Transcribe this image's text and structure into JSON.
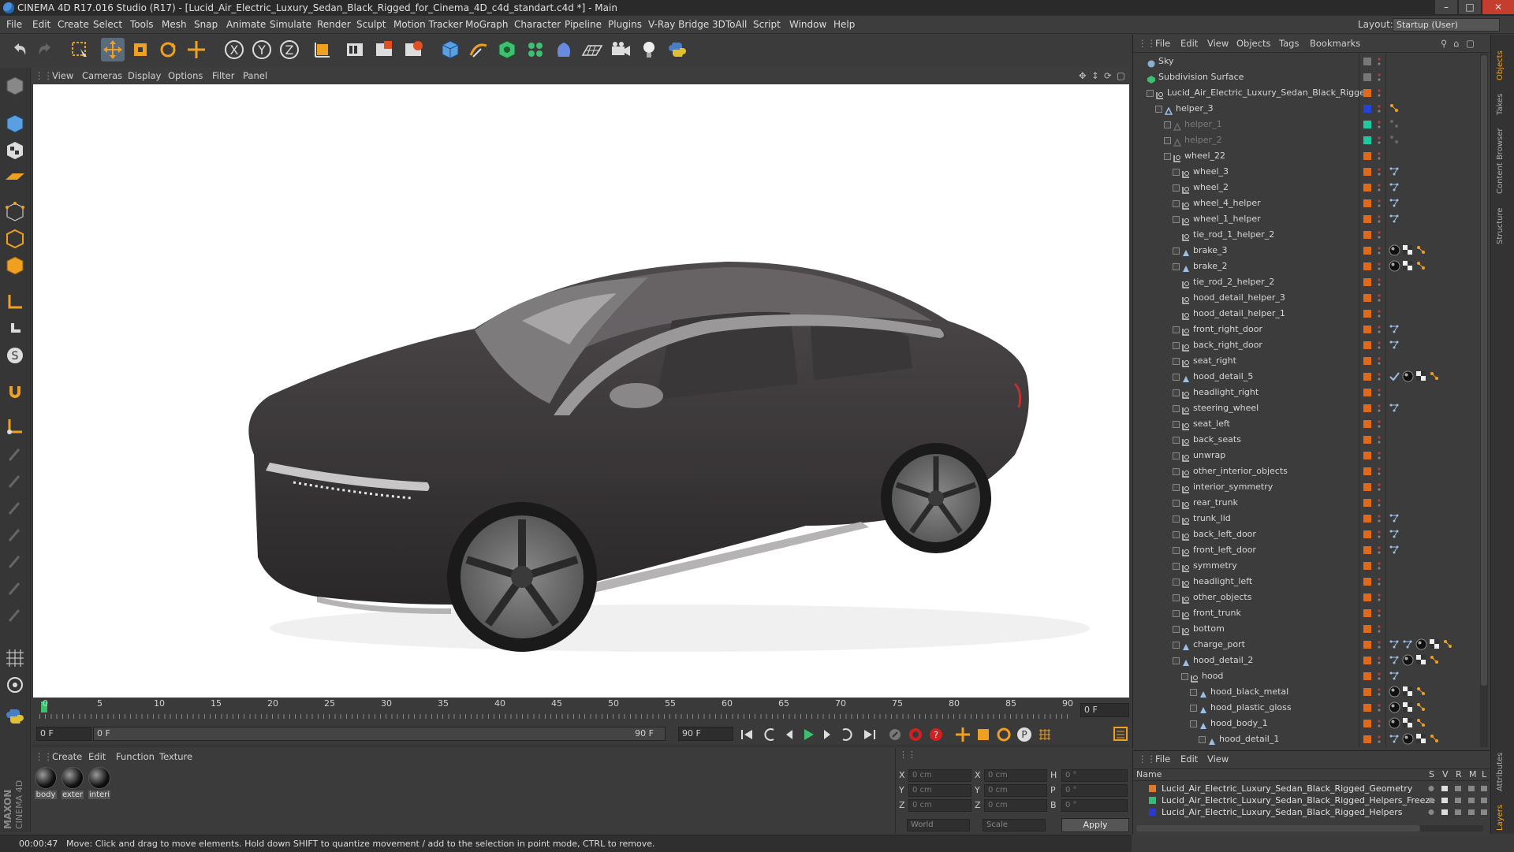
{
  "window": {
    "title": "CINEMA 4D R17.016 Studio (R17) - [Lucid_Air_Electric_Luxury_Sedan_Black_Rigged_for_Cinema_4D_c4d_standart.c4d *] - Main"
  },
  "menubar": {
    "items": [
      "File",
      "Edit",
      "Create",
      "Select",
      "Tools",
      "Mesh",
      "Snap",
      "Animate",
      "Simulate",
      "Render",
      "Sculpt",
      "Motion Tracker",
      "MoGraph",
      "Character",
      "Pipeline",
      "Plugins",
      "V-Ray Bridge",
      "3DToAll",
      "Script",
      "Window",
      "Help"
    ],
    "layout_label": "Layout:",
    "layout_value": "Startup (User)"
  },
  "viewport_menu": [
    "View",
    "Cameras",
    "Display",
    "Options",
    "Filter",
    "Panel"
  ],
  "timeline": {
    "ticks": [
      "0",
      "5",
      "10",
      "15",
      "20",
      "25",
      "30",
      "35",
      "40",
      "45",
      "50",
      "55",
      "60",
      "65",
      "70",
      "75",
      "80",
      "85",
      "90"
    ],
    "end_field": "0 F"
  },
  "playbar": {
    "current_frame": "0 F",
    "range_start": "0 F",
    "range_end": "90 F",
    "max_frame": "90 F"
  },
  "material_manager": {
    "menu": [
      "Create",
      "Edit",
      "Function",
      "Texture"
    ],
    "materials": [
      "body",
      "exter",
      "interi"
    ]
  },
  "coordinates": {
    "pos_labels": [
      "X",
      "Y",
      "Z"
    ],
    "size_labels": [
      "X",
      "Y",
      "Z"
    ],
    "rot_labels": [
      "H",
      "P",
      "B"
    ],
    "pos_values": [
      "0 cm",
      "0 cm",
      "0 cm"
    ],
    "size_values": [
      "0 cm",
      "0 cm",
      "0 cm"
    ],
    "rot_values": [
      "0 °",
      "0 °",
      "0 °"
    ],
    "mode1": "World",
    "mode2": "Scale",
    "apply_label": "Apply"
  },
  "status": {
    "time": "00:00:47",
    "message": "Move: Click and drag to move elements. Hold down SHIFT to quantize movement / add to the selection in point mode, CTRL to remove."
  },
  "object_manager": {
    "menu": [
      "File",
      "Edit",
      "View",
      "Objects",
      "Tags",
      "Bookmarks"
    ],
    "rows": [
      {
        "name": "Sky",
        "indent": 0,
        "icon": "sky",
        "vis": "grey",
        "dim": false,
        "tags": []
      },
      {
        "name": "Subdivision Surface",
        "indent": 0,
        "icon": "subdiv",
        "vis": "grey",
        "dim": false,
        "tags": []
      },
      {
        "name": "Lucid_Air_Electric_Luxury_Sedan_Black_Rigged",
        "indent": 1,
        "icon": "null",
        "vis": "orange",
        "dim": false,
        "tags": []
      },
      {
        "name": "helper_3",
        "indent": 2,
        "icon": "joint",
        "vis": "blue",
        "dim": false,
        "tags": [
          "ik"
        ]
      },
      {
        "name": "helper_1",
        "indent": 3,
        "icon": "joint",
        "vis": "teal",
        "dim": true,
        "tags": [
          "ik-dim"
        ]
      },
      {
        "name": "helper_2",
        "indent": 3,
        "icon": "joint",
        "vis": "teal",
        "dim": true,
        "tags": [
          "ik-dim"
        ]
      },
      {
        "name": "wheel_22",
        "indent": 3,
        "icon": "null",
        "vis": "orange",
        "dim": false,
        "tags": []
      },
      {
        "name": "wheel_3",
        "indent": 4,
        "icon": "null",
        "vis": "orange",
        "dim": false,
        "tags": [
          "xpresso"
        ]
      },
      {
        "name": "wheel_2",
        "indent": 4,
        "icon": "null",
        "vis": "orange",
        "dim": false,
        "tags": [
          "xpresso"
        ]
      },
      {
        "name": "wheel_4_helper",
        "indent": 4,
        "icon": "null",
        "vis": "orange",
        "dim": false,
        "tags": [
          "xpresso"
        ]
      },
      {
        "name": "wheel_1_helper",
        "indent": 4,
        "icon": "null",
        "vis": "orange",
        "dim": false,
        "tags": [
          "xpresso"
        ]
      },
      {
        "name": "tie_rod_1_helper_2",
        "indent": 4,
        "icon": "null",
        "vis": "orange",
        "dim": false,
        "tags": []
      },
      {
        "name": "brake_3",
        "indent": 4,
        "icon": "poly",
        "vis": "orange",
        "dim": false,
        "tags": [
          "mat",
          "check",
          "ik"
        ]
      },
      {
        "name": "brake_2",
        "indent": 4,
        "icon": "poly",
        "vis": "orange",
        "dim": false,
        "tags": [
          "mat",
          "check",
          "ik"
        ]
      },
      {
        "name": "tie_rod_2_helper_2",
        "indent": 4,
        "icon": "null",
        "vis": "orange",
        "dim": false,
        "tags": []
      },
      {
        "name": "hood_detail_helper_3",
        "indent": 4,
        "icon": "null",
        "vis": "orange",
        "dim": false,
        "tags": []
      },
      {
        "name": "hood_detail_helper_1",
        "indent": 4,
        "icon": "null",
        "vis": "orange",
        "dim": false,
        "tags": []
      },
      {
        "name": "front_right_door",
        "indent": 4,
        "icon": "null",
        "vis": "orange",
        "dim": false,
        "tags": [
          "xpresso"
        ]
      },
      {
        "name": "back_right_door",
        "indent": 4,
        "icon": "null",
        "vis": "orange",
        "dim": false,
        "tags": [
          "xpresso"
        ]
      },
      {
        "name": "seat_right",
        "indent": 4,
        "icon": "null",
        "vis": "orange",
        "dim": false,
        "tags": []
      },
      {
        "name": "hood_detail_5",
        "indent": 4,
        "icon": "poly",
        "vis": "orange",
        "dim": false,
        "tags": [
          "check2",
          "mat",
          "check",
          "ik"
        ]
      },
      {
        "name": "headlight_right",
        "indent": 4,
        "icon": "null",
        "vis": "orange",
        "dim": false,
        "tags": []
      },
      {
        "name": "steering_wheel",
        "indent": 4,
        "icon": "null",
        "vis": "orange",
        "dim": false,
        "tags": [
          "xpresso"
        ]
      },
      {
        "name": "seat_left",
        "indent": 4,
        "icon": "null",
        "vis": "orange",
        "dim": false,
        "tags": []
      },
      {
        "name": "back_seats",
        "indent": 4,
        "icon": "null",
        "vis": "orange",
        "dim": false,
        "tags": []
      },
      {
        "name": "unwrap",
        "indent": 4,
        "icon": "null",
        "vis": "orange",
        "dim": false,
        "tags": []
      },
      {
        "name": "other_interior_objects",
        "indent": 4,
        "icon": "null",
        "vis": "orange",
        "dim": false,
        "tags": []
      },
      {
        "name": "interior_symmetry",
        "indent": 4,
        "icon": "null",
        "vis": "orange",
        "dim": false,
        "tags": []
      },
      {
        "name": "rear_trunk",
        "indent": 4,
        "icon": "null",
        "vis": "orange",
        "dim": false,
        "tags": []
      },
      {
        "name": "trunk_lid",
        "indent": 4,
        "icon": "null",
        "vis": "orange",
        "dim": false,
        "tags": [
          "xpresso"
        ]
      },
      {
        "name": "back_left_door",
        "indent": 4,
        "icon": "null",
        "vis": "orange",
        "dim": false,
        "tags": [
          "xpresso"
        ]
      },
      {
        "name": "front_left_door",
        "indent": 4,
        "icon": "null",
        "vis": "orange",
        "dim": false,
        "tags": [
          "xpresso"
        ]
      },
      {
        "name": "symmetry",
        "indent": 4,
        "icon": "null",
        "vis": "orange",
        "dim": false,
        "tags": []
      },
      {
        "name": "headlight_left",
        "indent": 4,
        "icon": "null",
        "vis": "orange",
        "dim": false,
        "tags": []
      },
      {
        "name": "other_objects",
        "indent": 4,
        "icon": "null",
        "vis": "orange",
        "dim": false,
        "tags": []
      },
      {
        "name": "front_trunk",
        "indent": 4,
        "icon": "null",
        "vis": "orange",
        "dim": false,
        "tags": []
      },
      {
        "name": "bottom",
        "indent": 4,
        "icon": "null",
        "vis": "orange",
        "dim": false,
        "tags": []
      },
      {
        "name": "charge_port",
        "indent": 4,
        "icon": "poly",
        "vis": "orange",
        "dim": false,
        "tags": [
          "xpresso",
          "xpresso",
          "mat",
          "check",
          "ik"
        ]
      },
      {
        "name": "hood_detail_2",
        "indent": 4,
        "icon": "poly",
        "vis": "orange",
        "dim": false,
        "tags": [
          "xpresso",
          "mat",
          "check",
          "ik"
        ]
      },
      {
        "name": "hood",
        "indent": 5,
        "icon": "null",
        "vis": "orange",
        "dim": false,
        "tags": [
          "xpresso"
        ]
      },
      {
        "name": "hood_black_metal",
        "indent": 6,
        "icon": "poly",
        "vis": "orange",
        "dim": false,
        "tags": [
          "mat",
          "check",
          "ik"
        ]
      },
      {
        "name": "hood_plastic_gloss",
        "indent": 6,
        "icon": "poly",
        "vis": "orange",
        "dim": false,
        "tags": [
          "mat",
          "check",
          "ik"
        ]
      },
      {
        "name": "hood_body_1",
        "indent": 6,
        "icon": "poly",
        "vis": "orange",
        "dim": false,
        "tags": [
          "mat",
          "check",
          "ik"
        ]
      },
      {
        "name": "hood_detail_1",
        "indent": 7,
        "icon": "poly",
        "vis": "orange",
        "dim": false,
        "tags": [
          "xpresso",
          "mat",
          "check",
          "ik"
        ]
      }
    ]
  },
  "layer_manager": {
    "menu": [
      "File",
      "Edit",
      "View"
    ],
    "name_header": "Name",
    "col_headers": [
      "S",
      "V",
      "R",
      "M",
      "L"
    ],
    "layers": [
      {
        "name": "Lucid_Air_Electric_Luxury_Sedan_Black_Rigged_Geometry",
        "color": "#e07a2a"
      },
      {
        "name": "Lucid_Air_Electric_Luxury_Sedan_Black_Rigged_Helpers_Freeze",
        "color": "#2fbf7a"
      },
      {
        "name": "Lucid_Air_Electric_Luxury_Sedan_Black_Rigged_Helpers",
        "color": "#2a3ad0"
      }
    ]
  },
  "right_tabs": [
    "Objects",
    "Takes",
    "Content Browser",
    "Structure",
    "Attributes",
    "Layers"
  ],
  "brand": {
    "maxon": "MAXON",
    "cinema": "CINEMA 4D"
  },
  "colors": {
    "accent_orange": "#f0a020",
    "vis_orange": "#e06a1a",
    "vis_blue": "#2244dd",
    "vis_teal": "#1fc9a0"
  }
}
